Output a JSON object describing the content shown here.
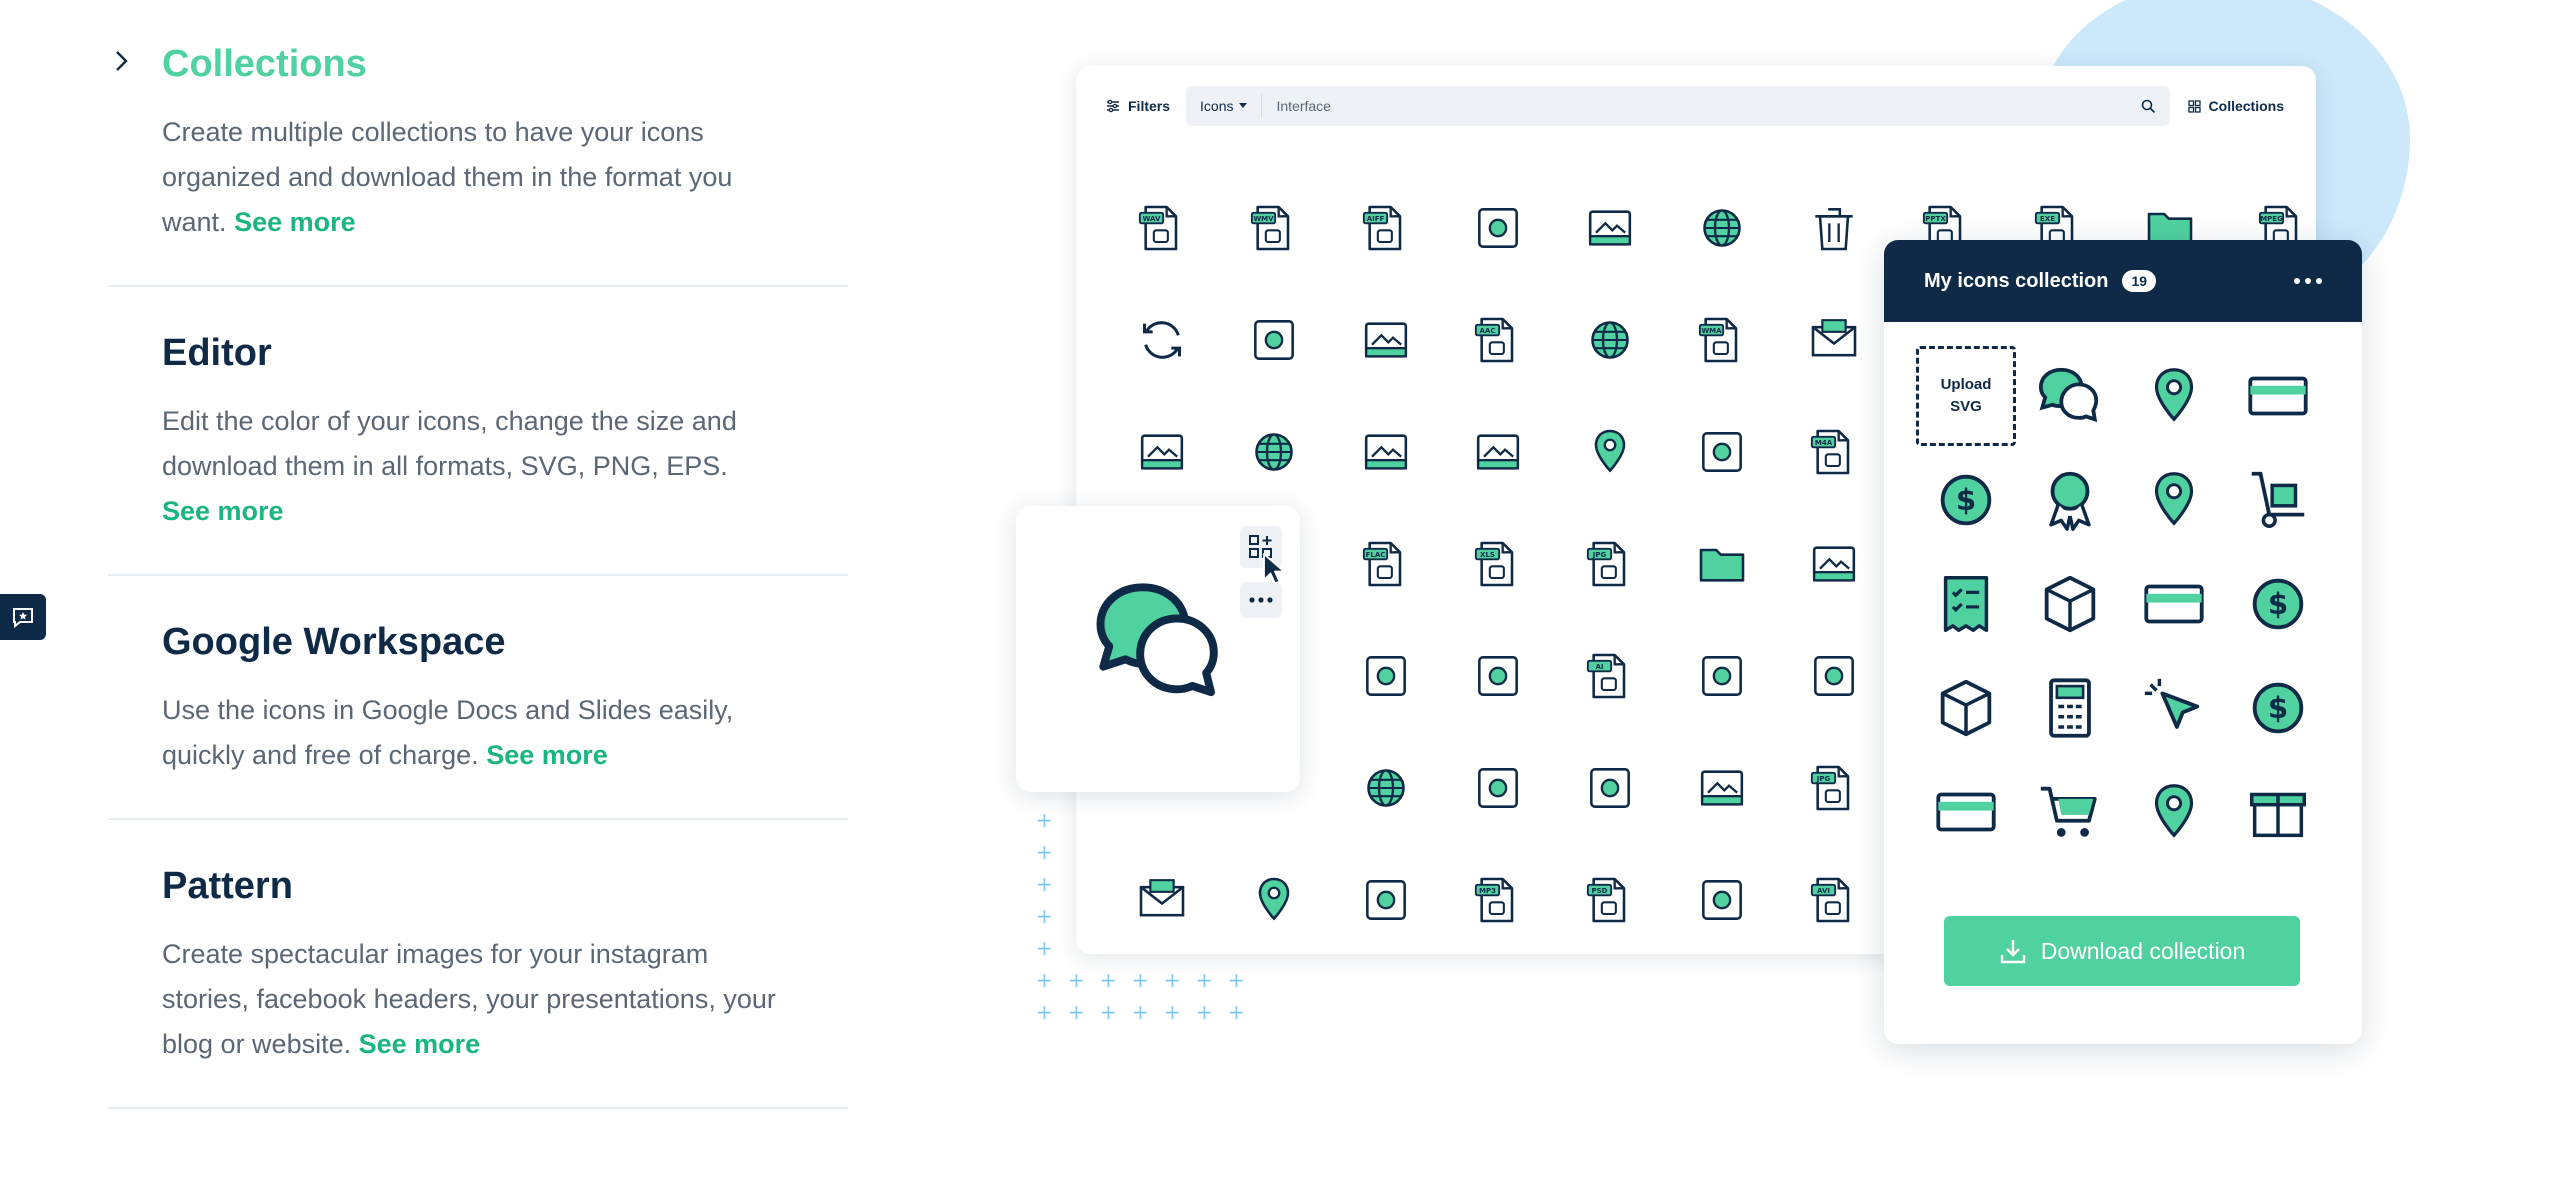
{
  "colors": {
    "navy": "#0e2a47",
    "green": "#4fd1a0",
    "link_green": "#1bb582",
    "gray_text": "#5b6775",
    "blob": "#cbe9fb"
  },
  "accordion": {
    "items": [
      {
        "title": "Collections",
        "description": "Create multiple collections to have your icons organized and download them in the format you want.",
        "link": "See more",
        "active": true
      },
      {
        "title": "Editor",
        "description": "Edit the color of your icons, change the size and download them in all formats, SVG, PNG, EPS.",
        "link": "See more",
        "active": false
      },
      {
        "title": "Google Workspace",
        "description": "Use the icons in Google Docs and Slides easily, quickly and free of charge.",
        "link": "See more",
        "active": false
      },
      {
        "title": "Pattern",
        "description": "Create spectacular images for your instagram stories, facebook headers, your presentations, your blog or website.",
        "link": "See more",
        "active": false
      }
    ]
  },
  "browser": {
    "filters_label": "Filters",
    "type_label": "Icons",
    "search_query": "Interface",
    "collections_label": "Collections"
  },
  "icon_grid": [
    [
      "wav-file-icon",
      "wmv-file-icon",
      "aiff-file-icon",
      "document-list-icon",
      "image-upload-icon",
      "globe-plane-icon",
      "trash-icon",
      "pptx-file-icon",
      "exe-file-icon",
      "folder-icon",
      "mpeg-file-icon"
    ],
    [
      "refresh-icon",
      "cloud-network-icon",
      "image-icon",
      "aac-file-icon",
      "globe-icon",
      "wma-file-icon",
      "mail-icon"
    ],
    [
      "camera-window-icon",
      "browser-globe-icon",
      "browser-edit-icon",
      "browser-image-icon",
      "location-pin-icon",
      "compass-icon",
      "m4a-file-icon"
    ],
    [
      "",
      "",
      "flac-file-icon",
      "xls-file-icon",
      "jpg-file-icon",
      "folder-open-icon",
      "photos-icon"
    ],
    [
      "",
      "",
      "calendar-icon",
      "flowchart-icon",
      "ai-file-icon",
      "map-icon",
      "sliders-icon"
    ],
    [
      "",
      "",
      "globe-icon",
      "network-icon",
      "user-profile-icon",
      "image-stack-icon",
      "jpg-file-icon"
    ],
    [
      "send-mail-icon",
      "location-icon",
      "video-frame-icon",
      "mp3-file-icon",
      "psd-file-icon",
      "camera-icon",
      "avi-file-icon"
    ]
  ],
  "hover_card": {
    "icon": "chat-bubbles-icon",
    "add_action": "add-to-collection-icon",
    "more_action": "more-options-icon"
  },
  "collection_panel": {
    "title": "My icons collection",
    "count": "19",
    "upload_label_line1": "Upload",
    "upload_label_line2": "SVG",
    "icons": [
      "chat-bubbles-icon",
      "shopping-bag-add-icon",
      "credit-card-stack-icon",
      "dollar-monitor-icon",
      "award-badge-icon",
      "shopping-cart-icon",
      "hand-truck-icon",
      "receipt-checklist-icon",
      "box-icon",
      "cash-icon",
      "coins-icon",
      "package-icon",
      "calculator-icon",
      "cursor-click-icon",
      "dollar-coin-icon",
      "credit-card-icon",
      "cart-download-icon",
      "location-pin-icon",
      "gift-icon"
    ],
    "download_label": "Download collection"
  }
}
